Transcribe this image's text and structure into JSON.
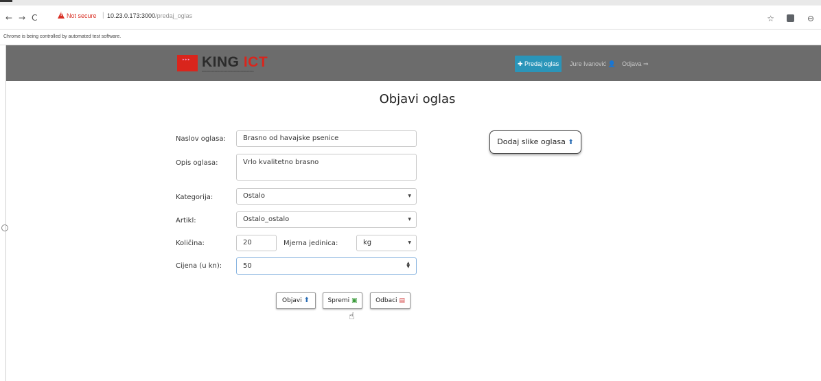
{
  "browser": {
    "security_label": "Not secure",
    "url_host": "10.23.0.173:3000",
    "url_path": "/predaj_oglas",
    "automation_notice": "Chrome is being controlled by automated test software."
  },
  "header": {
    "logo_text": "KING",
    "logo_text_accent": "ICT",
    "publish_button": "Predaj oglas",
    "user_name": "Jure Ivanović",
    "logout": "Odjava"
  },
  "form": {
    "title": "Objavi oglas",
    "naslov_label": "Naslov oglasa:",
    "naslov_value": "Brasno od havajske psenice",
    "opis_label": "Opis oglasa:",
    "opis_value": "Vrlo kvalitetno brasno",
    "kategorija_label": "Kategorija:",
    "kategorija_value": "Ostalo",
    "artikl_label": "Artikl:",
    "artikl_value": "Ostalo_ostalo",
    "kolicina_label": "Količina:",
    "kolicina_value": "20",
    "jedinica_label": "Mjerna jedinica:",
    "jedinica_value": "kg",
    "cijena_label": "Cijena (u kn):",
    "cijena_value": "50",
    "add_images_button": "Dodaj slike oglasa",
    "objavi_button": "Objavi",
    "spremi_button": "Spremi",
    "odbaci_button": "Odbaci"
  },
  "colors": {
    "header_bg": "#6c6c6c",
    "accent_button": "#2a95b9",
    "logo_red": "#d9251c"
  },
  "icons": [
    "back-arrow-icon",
    "forward-arrow-icon",
    "reload-icon",
    "warning-icon",
    "star-icon",
    "extension-icon",
    "account-icon",
    "plus-icon",
    "user-icon",
    "sign-out-icon",
    "upload-icon",
    "save-icon",
    "trash-icon",
    "hand-cursor-icon"
  ]
}
